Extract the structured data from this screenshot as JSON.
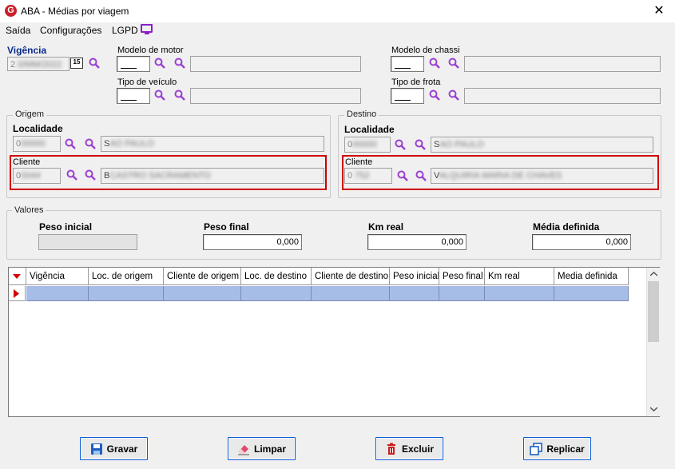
{
  "window": {
    "title": "ABA - Médias por viagem",
    "close": "✕",
    "logo": "G"
  },
  "menu": {
    "items": [
      "Saída",
      "Configurações",
      "LGPD"
    ]
  },
  "vigencia": {
    "label": "Vigência",
    "value": "2",
    "cal": "15"
  },
  "modelo_motor": {
    "label": "Modelo de motor",
    "code": "",
    "desc": ""
  },
  "modelo_chassi": {
    "label": "Modelo de chassi",
    "code": "",
    "desc": ""
  },
  "tipo_veiculo": {
    "label": "Tipo de veículo",
    "code": "",
    "desc": ""
  },
  "tipo_frota": {
    "label": "Tipo de frota",
    "code": "",
    "desc": ""
  },
  "origem": {
    "title": "Origem",
    "localidade": {
      "label": "Localidade",
      "code": "0",
      "desc": "S"
    },
    "cliente": {
      "label": "Cliente",
      "code": "0",
      "desc": "B"
    }
  },
  "destino": {
    "title": "Destino",
    "localidade": {
      "label": "Localidade",
      "code": "0",
      "desc": "S"
    },
    "cliente": {
      "label": "Cliente",
      "code": "0",
      "desc": "V"
    }
  },
  "valores": {
    "title": "Valores",
    "peso_inicial": {
      "label": "Peso inicial",
      "value": ""
    },
    "peso_final": {
      "label": "Peso final",
      "value": "0,000"
    },
    "km_real": {
      "label": "Km real",
      "value": "0,000"
    },
    "media_definida": {
      "label": "Média definida",
      "value": "0,000"
    }
  },
  "grid": {
    "columns": [
      "Vigência",
      "Loc. de origem",
      "Cliente de origem",
      "Loc. de destino",
      "Cliente de destino",
      "Peso inicial",
      "Peso final",
      "Km real",
      "Media definida"
    ]
  },
  "buttons": {
    "gravar": "Gravar",
    "limpar": "Limpar",
    "excluir": "Excluir",
    "replicar": "Replicar"
  },
  "colors": {
    "accent": "#0a5ad6",
    "search_icon": "#9b3fd1",
    "highlight_box": "#d00000",
    "selected_row": "#a6bde8"
  }
}
